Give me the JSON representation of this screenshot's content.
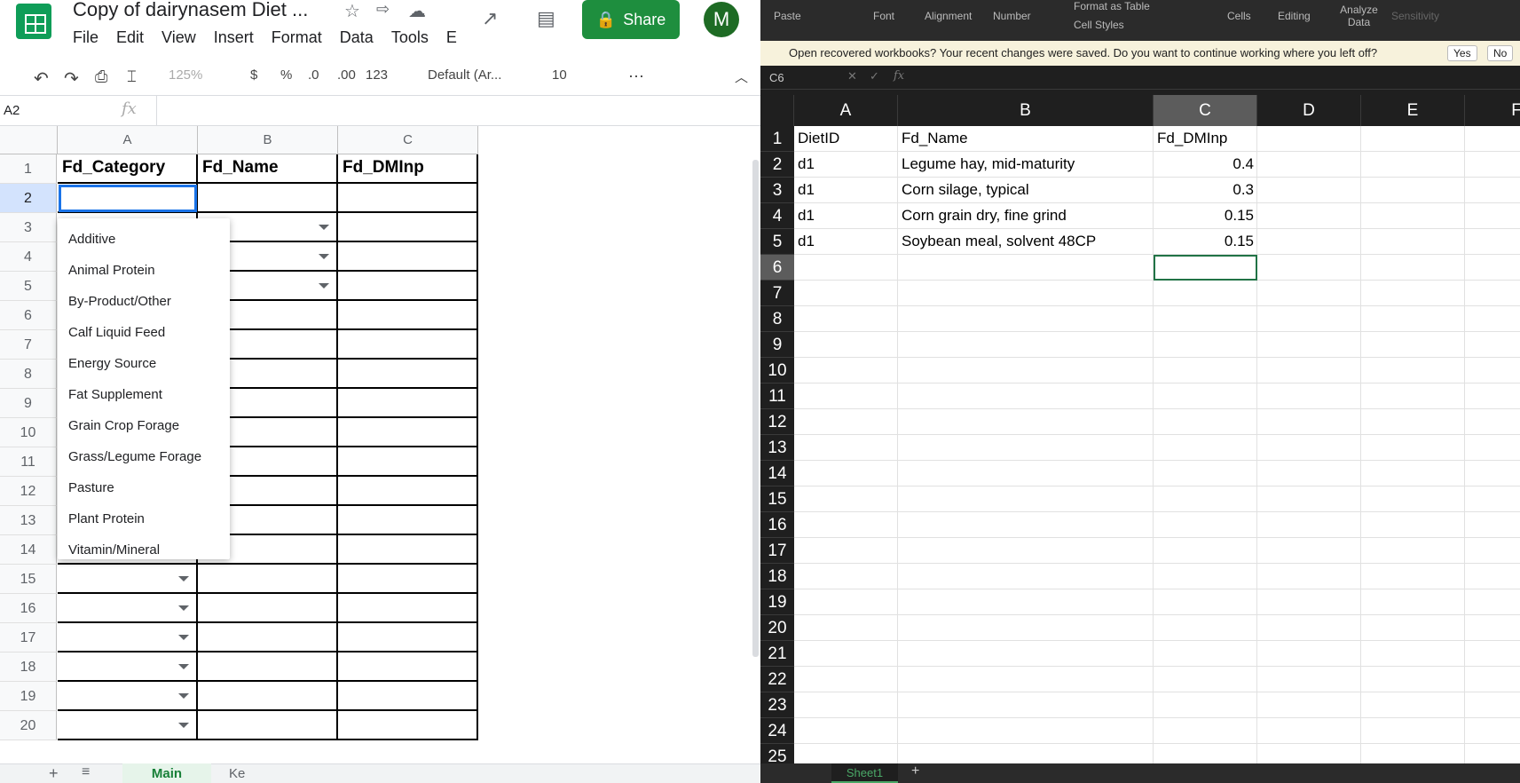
{
  "gsheets": {
    "title": "Copy of dairynasem Diet ...",
    "menu": [
      "File",
      "Edit",
      "View",
      "Insert",
      "Format",
      "Data",
      "Tools",
      "E"
    ],
    "share_label": "Share",
    "avatar_letter": "M",
    "toolbar": {
      "zoom": "125%",
      "currency": "$",
      "percent": "%",
      "dec_less": ".0",
      "dec_more": ".00",
      "format_num": "123",
      "font": "Default (Ar...",
      "font_size": "10"
    },
    "name_box": "A2",
    "fx_label": "fx",
    "columns": [
      "A",
      "B",
      "C"
    ],
    "rows": [
      "1",
      "2",
      "3",
      "4",
      "5",
      "6",
      "7",
      "8",
      "9",
      "10",
      "11",
      "12",
      "13",
      "14",
      "15",
      "16",
      "17",
      "18",
      "19",
      "20"
    ],
    "headers": [
      "Fd_Category",
      "Fd_Name",
      "Fd_DMInp"
    ],
    "dropdown_options": [
      "Additive",
      "Animal Protein",
      "By-Product/Other",
      "Calf Liquid Feed",
      "Energy Source",
      "Fat Supplement",
      "Grain Crop Forage",
      "Grass/Legume Forage",
      "Pasture",
      "Plant Protein",
      "Vitamin/Mineral"
    ],
    "sheet_tabs": [
      "Main",
      "Ke"
    ]
  },
  "excel": {
    "ribbon": [
      "Paste",
      "Font",
      "Alignment",
      "Number",
      "Format as Table",
      "Cell Styles",
      "Cells",
      "Editing",
      "Analyze Data",
      "Sensitivity"
    ],
    "message": "Open recovered workbooks?  Your recent changes were saved. Do you want to continue working where you left off?",
    "yes_label": "Yes",
    "no_label": "No",
    "name_box": "C6",
    "fx_label": "fx",
    "columns": [
      "A",
      "B",
      "C",
      "D",
      "E",
      "F"
    ],
    "rows": [
      "1",
      "2",
      "3",
      "4",
      "5",
      "6",
      "7",
      "8",
      "9",
      "10",
      "11",
      "12",
      "13",
      "14",
      "15",
      "16",
      "17",
      "18",
      "19",
      "20",
      "21",
      "22",
      "23",
      "24",
      "25"
    ],
    "table": {
      "header": [
        "DietID",
        "Fd_Name",
        "Fd_DMInp"
      ],
      "data": [
        [
          "d1",
          "Legume hay, mid-maturity",
          "0.4"
        ],
        [
          "d1",
          "Corn silage, typical",
          "0.3"
        ],
        [
          "d1",
          "Corn grain dry, fine grind",
          "0.15"
        ],
        [
          "d1",
          "Soybean meal, solvent 48CP",
          "0.15"
        ]
      ]
    },
    "sheet_tab": "Sheet1",
    "add_sheet": "+"
  }
}
